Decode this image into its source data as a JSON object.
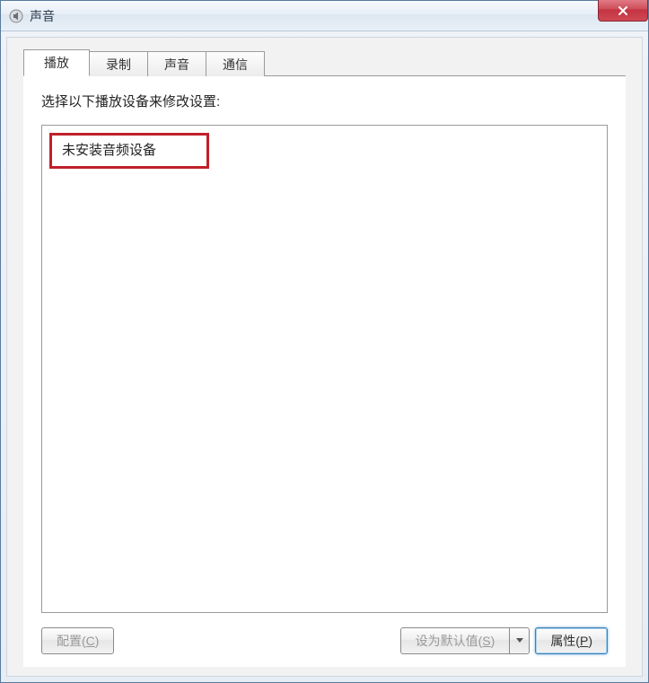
{
  "window": {
    "title": "声音"
  },
  "tabs": [
    {
      "label": "播放"
    },
    {
      "label": "录制"
    },
    {
      "label": "声音"
    },
    {
      "label": "通信"
    }
  ],
  "panel": {
    "instruction": "选择以下播放设备来修改设置:",
    "no_device_text": "未安装音频设备"
  },
  "buttons": {
    "configure": "配置(C)",
    "set_default": "设为默认值(S)",
    "properties": "属性(P)"
  }
}
